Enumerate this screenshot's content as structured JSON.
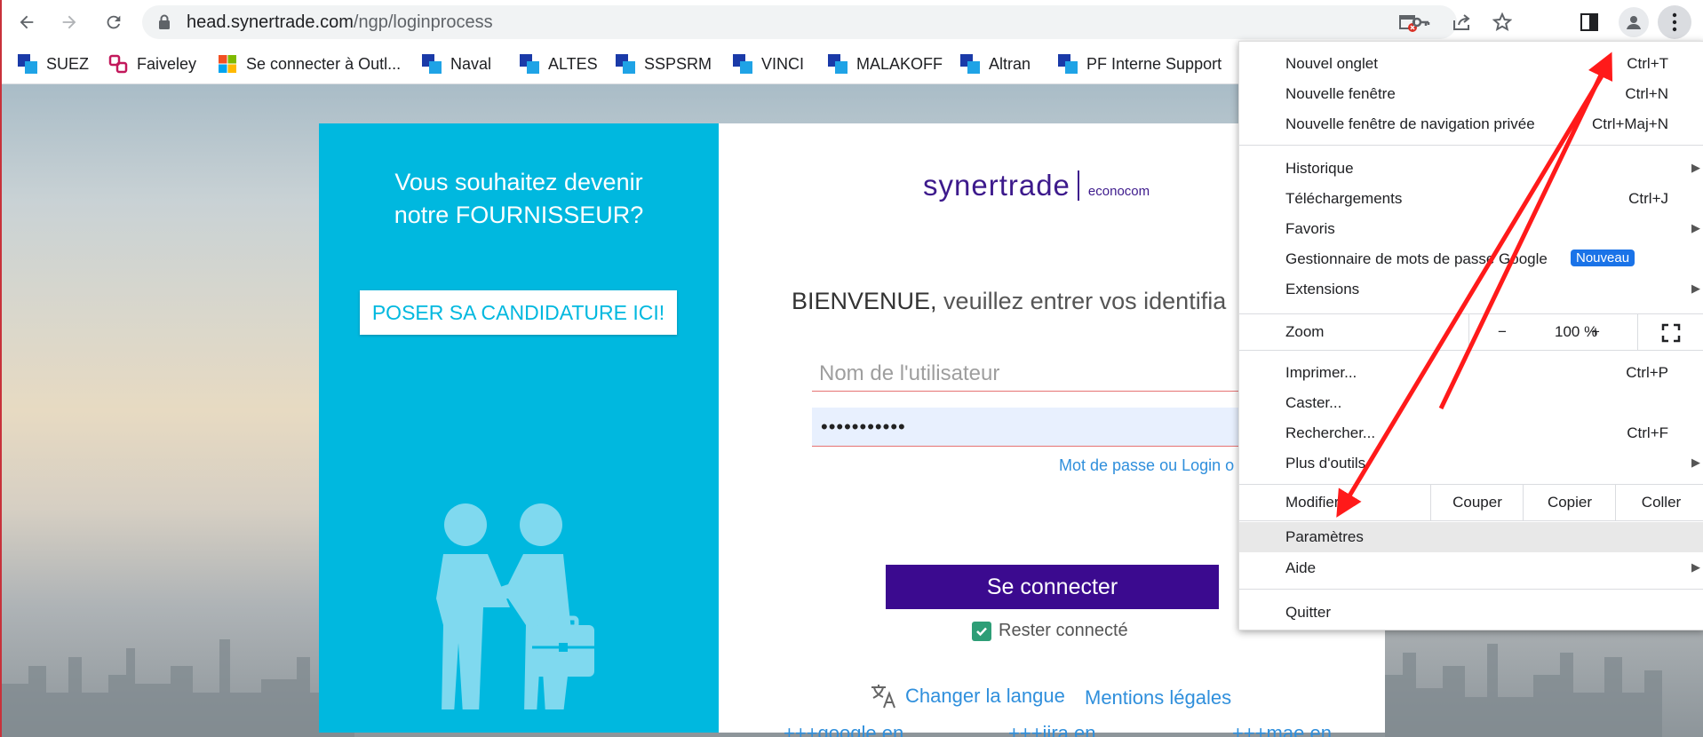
{
  "browser": {
    "url_host": "head.synertrade.com",
    "url_path": "/ngp/loginprocess",
    "icons": [
      "back-icon",
      "forward-icon",
      "reload-icon",
      "lock-icon",
      "site-blocked-icon",
      "key-icon",
      "share-icon",
      "star-icon",
      "side-panel-icon",
      "profile-icon",
      "kebab-menu-icon"
    ]
  },
  "bookmarks": [
    {
      "label": "SUEZ",
      "icon": "suez-icon"
    },
    {
      "label": "Faiveley",
      "icon": "faiveley-icon"
    },
    {
      "label": "Se connecter à Outl...",
      "icon": "microsoft-icon"
    },
    {
      "label": "Naval",
      "icon": "bookmark-icon"
    },
    {
      "label": "ALTES",
      "icon": "bookmark-icon"
    },
    {
      "label": "SSPSRM",
      "icon": "bookmark-icon"
    },
    {
      "label": "VINCI",
      "icon": "bookmark-icon"
    },
    {
      "label": "MALAKOFF",
      "icon": "bookmark-icon"
    },
    {
      "label": "Altran",
      "icon": "bookmark-icon"
    },
    {
      "label": "PF Interne Support",
      "icon": "bookmark-icon"
    }
  ],
  "supplier_panel": {
    "title_line1": "Vous souhaitez devenir",
    "title_line2": "notre FOURNISSEUR?",
    "button": "POSER SA CANDIDATURE ICI!"
  },
  "login": {
    "logo_brand": "synertrade",
    "logo_sub": "econocom",
    "welcome_bold": "BIENVENUE,",
    "welcome_rest": " veuillez entrer vos identifia",
    "username_placeholder": "Nom de l'utilisateur",
    "password_value": "•••••••••••",
    "forgot": "Mot de passe ou Login o",
    "connect": "Se connecter",
    "remember": "Rester connecté",
    "change_language": "Changer la langue",
    "legal": "Mentions légales",
    "links": [
      "+++google.en",
      "+++jira.en",
      "+++mae.en"
    ]
  },
  "menu": {
    "new_tab": "Nouvel onglet",
    "new_tab_sc": "Ctrl+T",
    "new_window": "Nouvelle fenêtre",
    "new_window_sc": "Ctrl+N",
    "incognito": "Nouvelle fenêtre de navigation privée",
    "incognito_sc": "Ctrl+Maj+N",
    "history": "Historique",
    "downloads": "Téléchargements",
    "downloads_sc": "Ctrl+J",
    "favorites": "Favoris",
    "passwords": "Gestionnaire de mots de passe Google",
    "new_badge": "Nouveau",
    "extensions": "Extensions",
    "zoom": "Zoom",
    "zoom_minus": "−",
    "zoom_value": "100 %",
    "zoom_plus": "+",
    "print": "Imprimer...",
    "print_sc": "Ctrl+P",
    "cast": "Caster...",
    "find": "Rechercher...",
    "find_sc": "Ctrl+F",
    "more_tools": "Plus d'outils",
    "edit": "Modifier",
    "cut": "Couper",
    "copy": "Copier",
    "paste": "Coller",
    "settings": "Paramètres",
    "help": "Aide",
    "quit": "Quitter"
  },
  "colors": {
    "accent_blue": "#00b8df",
    "button_purple": "#3b0a8f",
    "link": "#2f8fdc",
    "arrow": "#ff1a1a"
  }
}
